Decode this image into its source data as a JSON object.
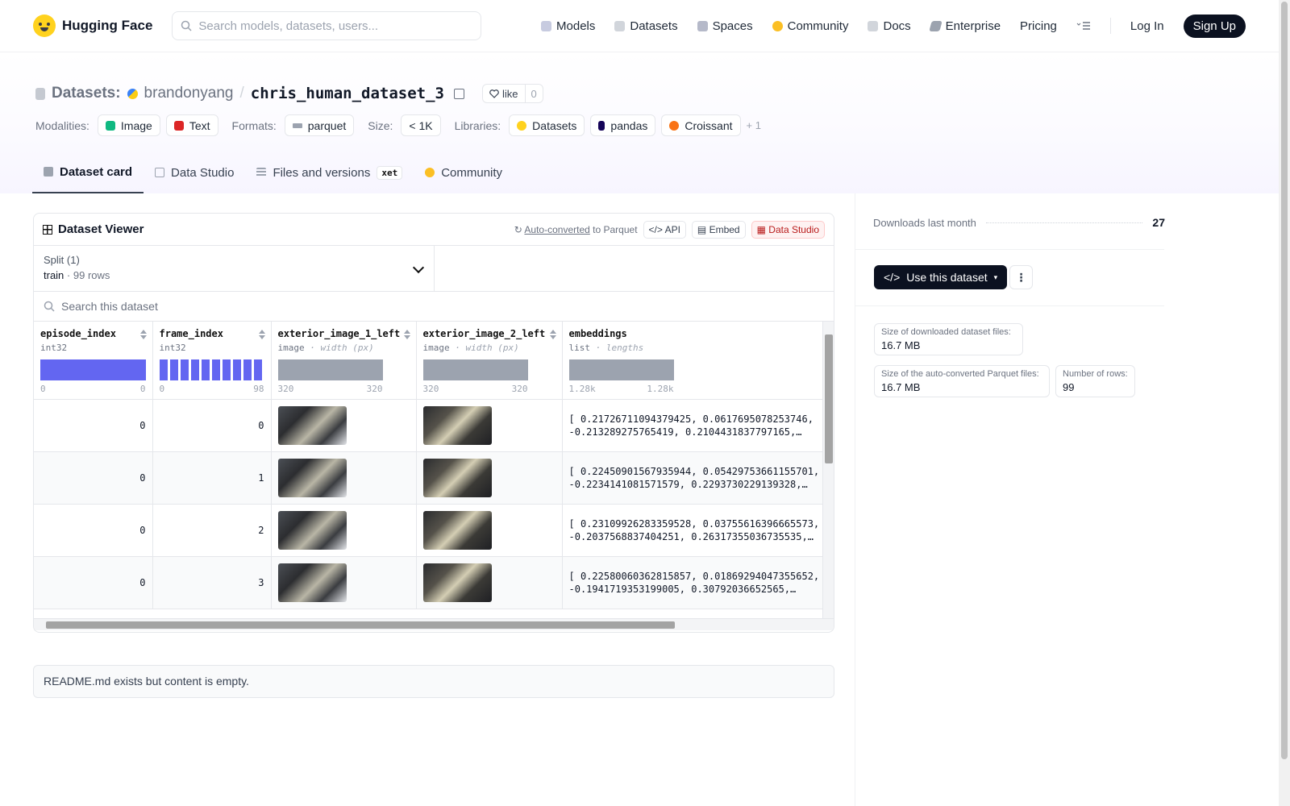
{
  "nav": {
    "brand": "Hugging Face",
    "search_placeholder": "Search models, datasets, users...",
    "links": [
      "Models",
      "Datasets",
      "Spaces",
      "Community",
      "Docs",
      "Enterprise",
      "Pricing"
    ],
    "login": "Log In",
    "signup": "Sign Up"
  },
  "header": {
    "section": "Datasets:",
    "owner": "brandonyang",
    "separator": "/",
    "name": "chris_human_dataset_3",
    "like_label": "like",
    "like_count": "0",
    "modalities_label": "Modalities:",
    "modalities": [
      "Image",
      "Text"
    ],
    "formats_label": "Formats:",
    "format": "parquet",
    "size_label": "Size:",
    "size": "< 1K",
    "libraries_label": "Libraries:",
    "libraries": [
      "Datasets",
      "pandas",
      "Croissant"
    ],
    "more_libraries": "+ 1"
  },
  "tabs": [
    "Dataset card",
    "Data Studio",
    "Files and versions",
    "Community"
  ],
  "tab_badge": "xet",
  "viewer": {
    "title": "Dataset Viewer",
    "auto_converted": "Auto-converted",
    "to_parquet": "to Parquet",
    "api": "API",
    "embed": "Embed",
    "data_studio": "Data Studio",
    "split_label": "Split (1)",
    "split_name": "train",
    "split_dot": "·",
    "split_rows": "99 rows",
    "search_placeholder": "Search this dataset",
    "columns": [
      {
        "name": "episode_index",
        "type": "int32",
        "sub": "",
        "min": "0",
        "max": "0"
      },
      {
        "name": "frame_index",
        "type": "int32",
        "sub": "",
        "min": "0",
        "max": "98"
      },
      {
        "name": "exterior_image_1_left",
        "type": "image",
        "sub": "· width (px)",
        "min": "320",
        "max": "320"
      },
      {
        "name": "exterior_image_2_left",
        "type": "image",
        "sub": "· width (px)",
        "min": "320",
        "max": "320"
      },
      {
        "name": "embeddings",
        "type": "list",
        "sub": "· lengths",
        "min": "1.28k",
        "max": "1.28k"
      }
    ],
    "rows": [
      {
        "episode_index": "0",
        "frame_index": "0",
        "embeddings": "[ 0.21726711094379425, 0.0617695078253746,\n-0.213289275765419, 0.2104431837797165,…"
      },
      {
        "episode_index": "0",
        "frame_index": "1",
        "embeddings": "[ 0.22450901567935944, 0.05429753661155701,\n-0.2234141081571579, 0.2293730229139328,…"
      },
      {
        "episode_index": "0",
        "frame_index": "2",
        "embeddings": "[ 0.23109926283359528, 0.03755616396665573,\n-0.2037568837404251, 0.26317355036735535,…"
      },
      {
        "episode_index": "0",
        "frame_index": "3",
        "embeddings": "[ 0.22580060362815857, 0.01869294047355652,\n-0.1941719353199005, 0.30792036652565,…"
      }
    ]
  },
  "readme": "README.md exists but content is empty.",
  "sidebar": {
    "downloads_label": "Downloads last month",
    "downloads_value": "27",
    "use_dataset": "Use this dataset",
    "more": "⋮",
    "size_downloaded_label": "Size of downloaded dataset files:",
    "size_downloaded_value": "16.7 MB",
    "size_parquet_label": "Size of the auto-converted Parquet files:",
    "size_parquet_value": "16.7 MB",
    "num_rows_label": "Number of rows:",
    "num_rows_value": "99"
  },
  "colors": {
    "accent": "#6366f1",
    "dark": "#0b1120",
    "yellow": "#ffd21e"
  }
}
